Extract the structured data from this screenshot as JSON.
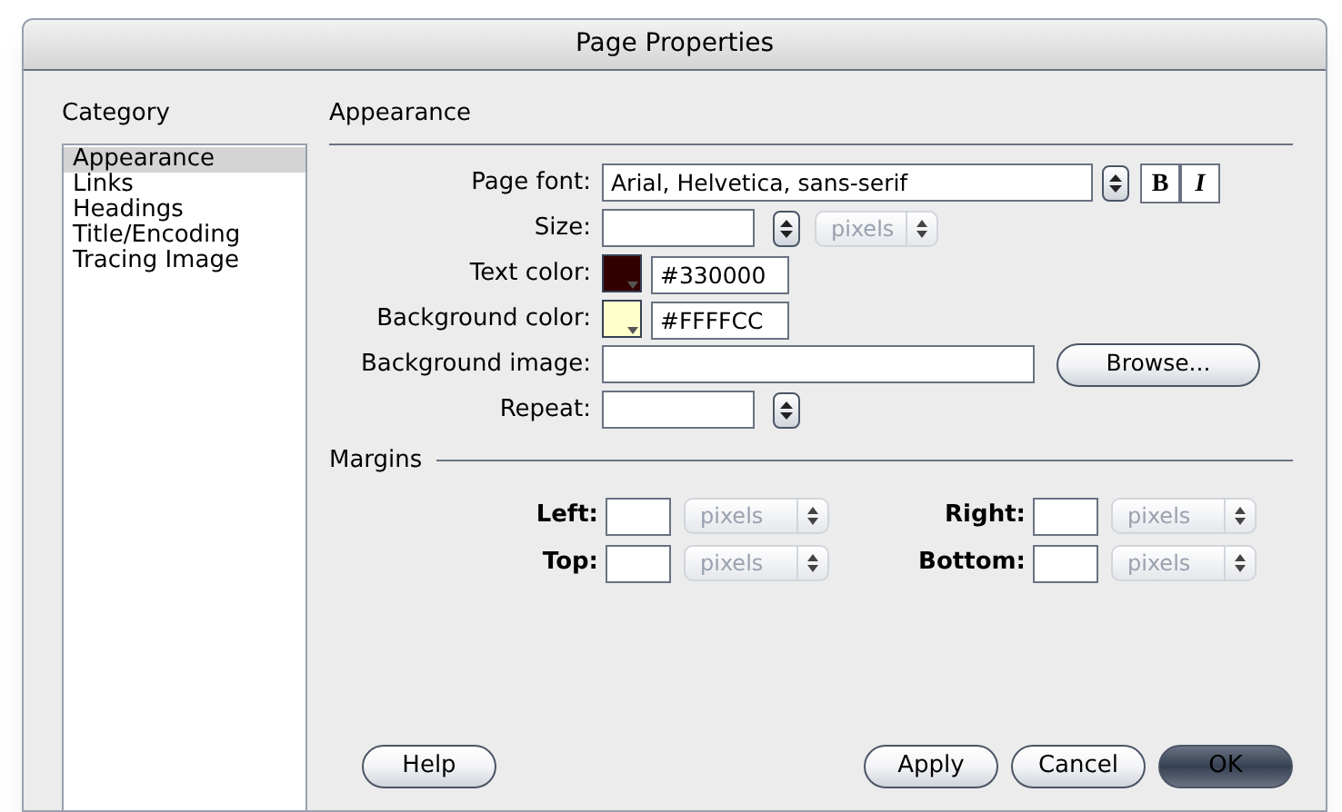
{
  "window": {
    "title": "Page Properties"
  },
  "category": {
    "heading": "Category",
    "items": [
      {
        "label": "Appearance",
        "selected": true
      },
      {
        "label": "Links",
        "selected": false
      },
      {
        "label": "Headings",
        "selected": false
      },
      {
        "label": "Title/Encoding",
        "selected": false
      },
      {
        "label": "Tracing Image",
        "selected": false
      }
    ]
  },
  "section_heading": "Appearance",
  "fields": [
    {
      "kind": "font",
      "label": "Page font:",
      "value": "Arial, Helvetica, sans-serif",
      "bold": "B",
      "italic": "I"
    },
    {
      "kind": "size",
      "label": "Size:",
      "unit": "pixels",
      "disabled": true
    },
    {
      "kind": "color",
      "label": "Text color:",
      "value": "#330000"
    },
    {
      "kind": "color",
      "label": "Background color:",
      "value": "#FFFFCC"
    },
    {
      "kind": "image",
      "label": "Background image:",
      "button": "Browse..."
    },
    {
      "kind": "select",
      "label": "Repeat:"
    }
  ],
  "margins": {
    "heading": "Margins",
    "items": [
      {
        "label": "Left:",
        "unit": "pixels",
        "disabled": true
      },
      {
        "label": "Right:",
        "unit": "pixels",
        "disabled": true
      },
      {
        "label": "Top:",
        "unit": "pixels",
        "disabled": true
      },
      {
        "label": "Bottom:",
        "unit": "pixels",
        "disabled": true
      }
    ]
  },
  "buttons": [
    {
      "label": "Help",
      "kind": "help"
    },
    {
      "label": "Apply",
      "kind": "normal"
    },
    {
      "label": "Cancel",
      "kind": "normal"
    },
    {
      "label": "OK",
      "kind": "default"
    }
  ]
}
